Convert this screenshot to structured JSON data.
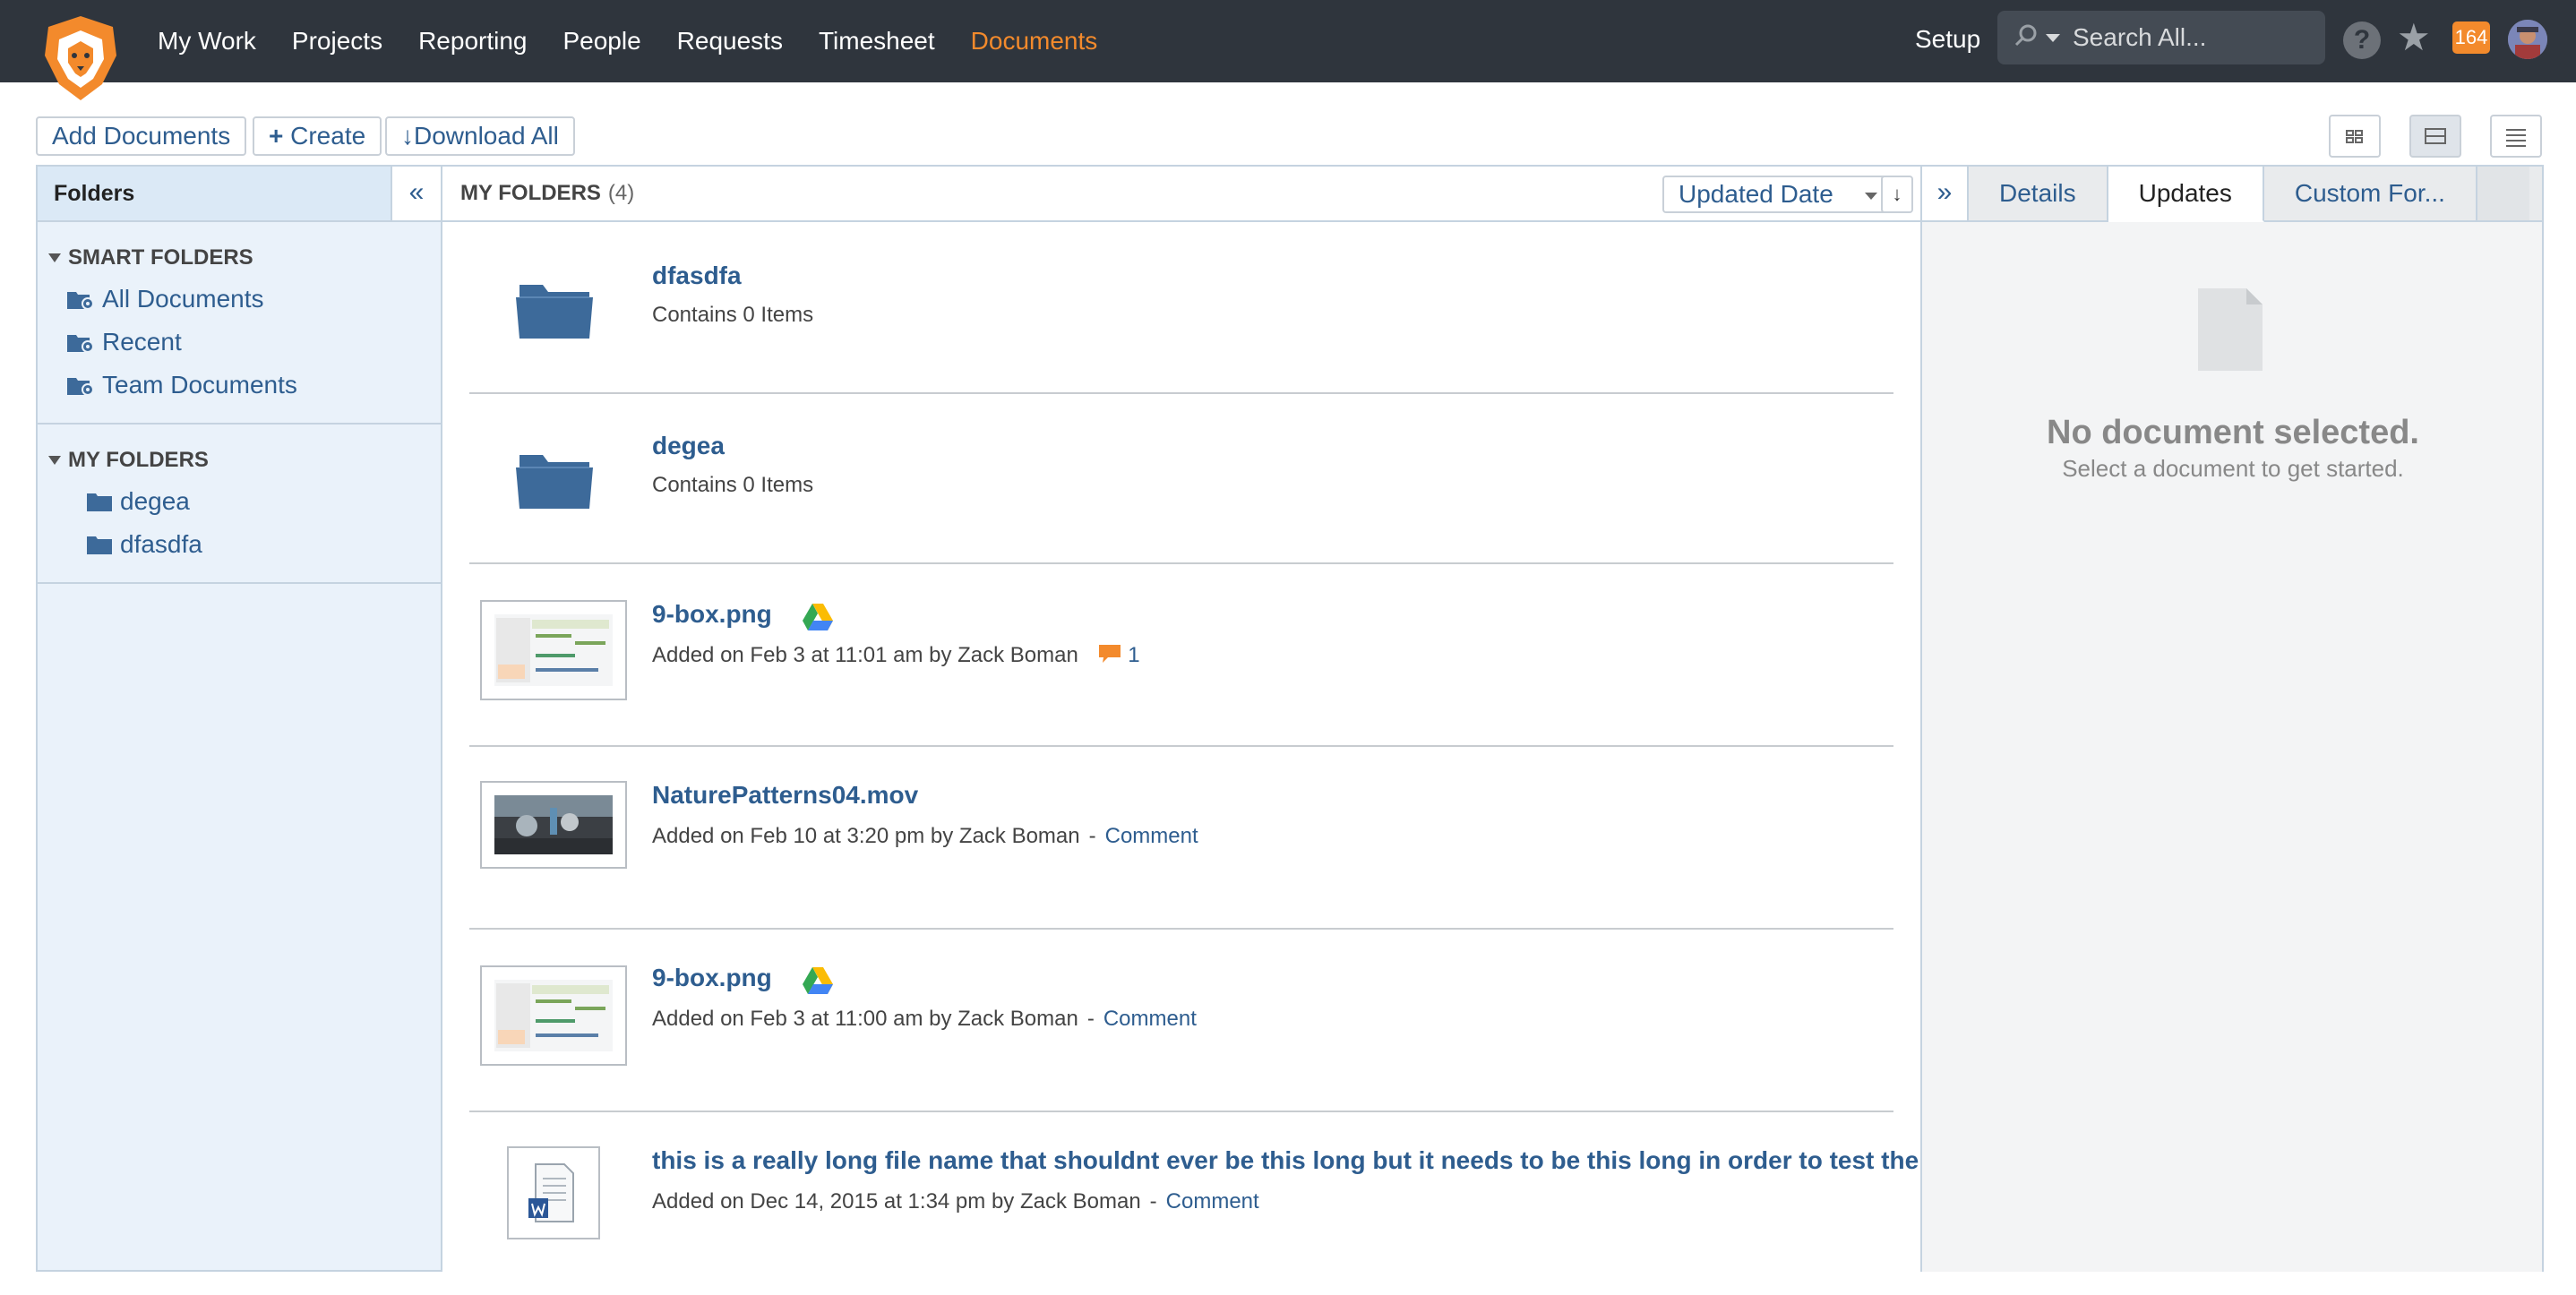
{
  "nav": {
    "items": [
      "My Work",
      "Projects",
      "Reporting",
      "People",
      "Requests",
      "Timesheet",
      "Documents"
    ],
    "active": "Documents",
    "setup": "Setup",
    "search_placeholder": "Search All...",
    "notification_count": "164",
    "accent_color": "#f38a2c"
  },
  "toolbar": {
    "add_label": "Add Documents",
    "create_label": "Create",
    "download_label": "Download All"
  },
  "folders_panel": {
    "title": "Folders",
    "collapse_glyph": "«",
    "smart_title": "SMART FOLDERS",
    "smart_items": [
      "All Documents",
      "Recent",
      "Team Documents"
    ],
    "my_title": "MY FOLDERS",
    "my_items": [
      "degea",
      "dfasdfa"
    ]
  },
  "main": {
    "title": "MY FOLDERS",
    "count": "(4)",
    "sort_label": "Updated Date",
    "rows": [
      {
        "name": "dfasdfa",
        "meta": "Contains 0 Items",
        "kind": "folder"
      },
      {
        "name": "degea",
        "meta": "Contains 0 Items",
        "kind": "folder"
      },
      {
        "name": "9-box.png",
        "meta": "Added on Feb 3 at 11:01 am by Zack Boman",
        "comment_count": "1",
        "kind": "image",
        "gdrive": true
      },
      {
        "name": "NaturePatterns04.mov",
        "meta": "Added on Feb 10 at 3:20 pm by Zack Boman",
        "sep": "-",
        "comment": "Comment",
        "kind": "video"
      },
      {
        "name": "9-box.png",
        "meta": "Added on Feb 3 at 11:00 am by Zack Boman",
        "sep": "-",
        "comment": "Comment",
        "kind": "image",
        "gdrive": true
      },
      {
        "name": "this is a really long file name that shouldnt ever be this long but it needs to be this long in order to test the ...",
        "meta": "Added on Dec 14, 2015 at 1:34 pm by Zack Boman",
        "sep": "-",
        "comment": "Comment",
        "kind": "word"
      }
    ]
  },
  "details_panel": {
    "expand_glyph": "»",
    "tabs": [
      "Details",
      "Updates",
      "Custom For..."
    ],
    "active_tab": "Updates",
    "empty_title": "No document selected.",
    "empty_subtitle": "Select a document to get started."
  }
}
